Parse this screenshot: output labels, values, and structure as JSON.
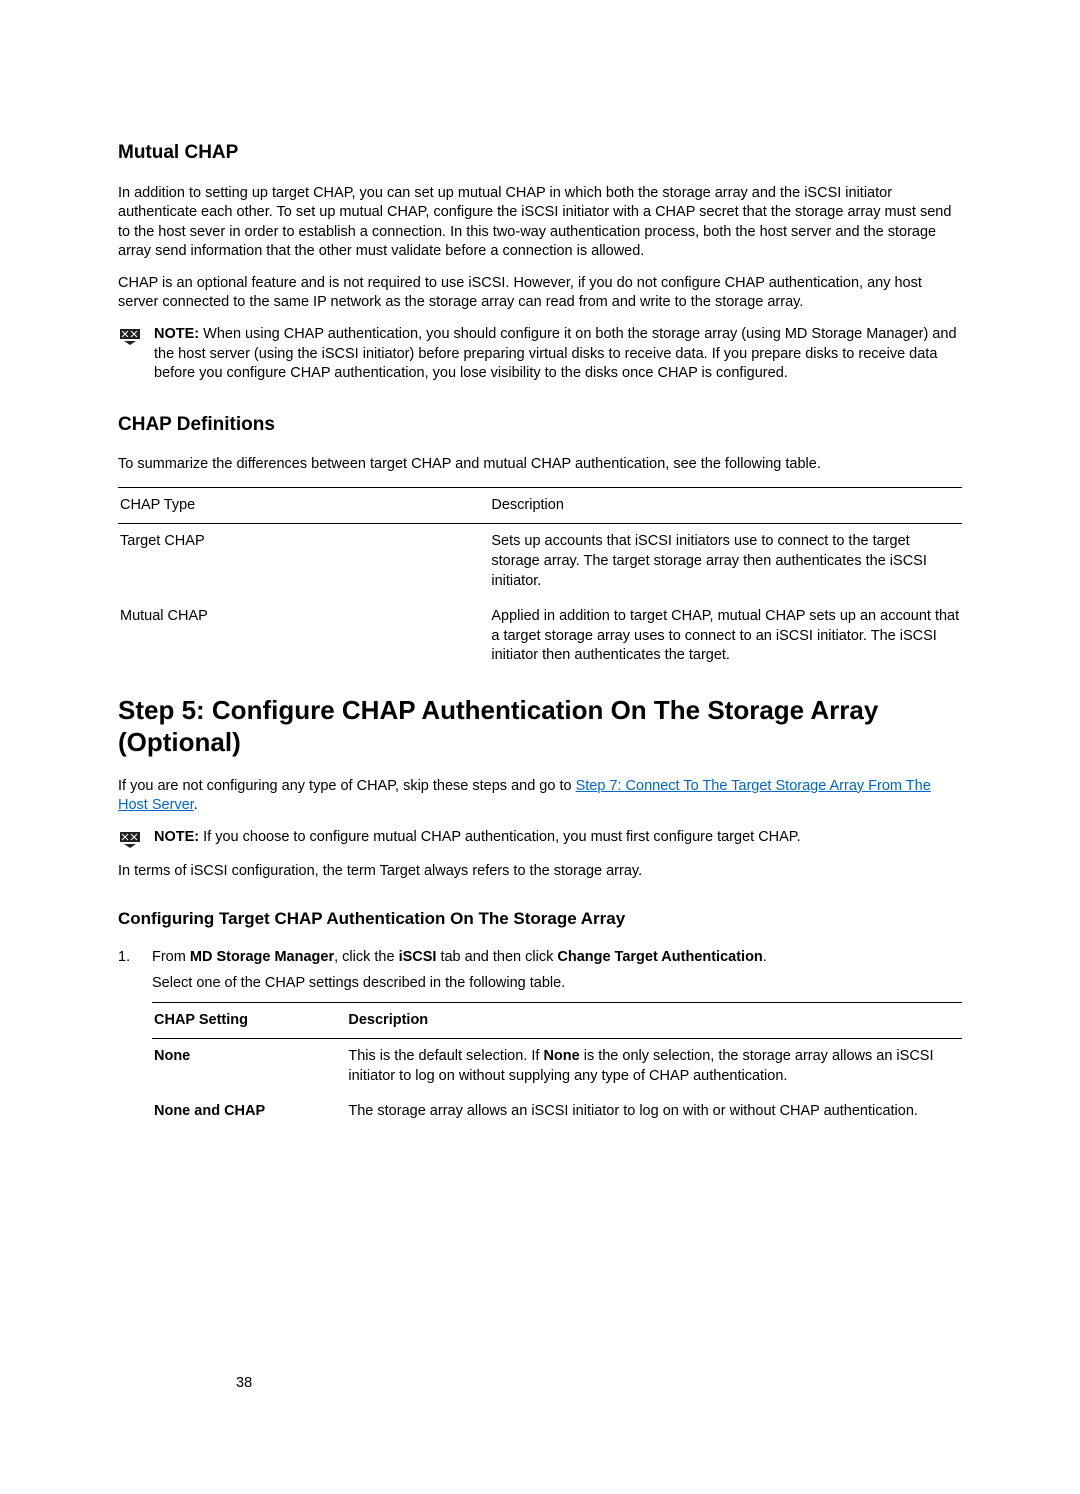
{
  "mutual": {
    "heading": "Mutual CHAP",
    "p1": "In addition to setting up target CHAP, you can set up mutual CHAP in which both the storage array and the iSCSI initiator authenticate each other. To set up mutual CHAP, configure the iSCSI initiator with a CHAP secret that the storage array must send to the host sever in order to establish a connection. In this two-way authentication process, both the host server and the storage array send information that the other must validate before a connection is allowed.",
    "p2": "CHAP is an optional feature and is not required to use iSCSI. However, if you do not configure CHAP authentication, any host server connected to the same IP network as the storage array can read from and write to the storage array.",
    "note_label": "NOTE: ",
    "note_body": "When using CHAP authentication, you should configure it on both the storage array (using MD Storage Manager) and the host server (using the iSCSI initiator) before preparing virtual disks to receive data. If you prepare disks to receive data before you configure CHAP authentication, you lose visibility to the disks once CHAP is configured."
  },
  "defs": {
    "heading": "CHAP Definitions",
    "intro": "To summarize the differences between target CHAP and mutual CHAP authentication, see the following table.",
    "col1": "CHAP Type",
    "col2": "Description",
    "rows": [
      {
        "type": "Target CHAP",
        "desc": "Sets up accounts that iSCSI initiators use to connect to the target storage array. The target storage array then authenticates the iSCSI initiator."
      },
      {
        "type": "Mutual CHAP",
        "desc": "Applied in addition to target CHAP, mutual CHAP sets up an account that a target storage array uses to connect to an iSCSI initiator. The iSCSI initiator then authenticates the target."
      }
    ]
  },
  "step5": {
    "title": "Step 5: Configure CHAP Authentication On The Storage Array (Optional)",
    "p1_a": "If you are not configuring any type of CHAP, skip these steps and go to ",
    "p1_link": "Step 7: Connect To The Target Storage Array From The Host Server",
    "p1_b": ".",
    "note_label": "NOTE: ",
    "note_body": "If you choose to configure mutual CHAP authentication, you must first configure target CHAP.",
    "p2": "In terms of iSCSI configuration, the term Target always refers to the storage array."
  },
  "configure": {
    "heading": "Configuring Target CHAP Authentication On The Storage Array",
    "step1_num": "1.",
    "step1_a": "From ",
    "step1_b": "MD Storage Manager",
    "step1_c": ", click the ",
    "step1_d": "iSCSI",
    "step1_e": " tab and then click ",
    "step1_f": "Change Target Authentication",
    "step1_g": ".",
    "step1_sub": "Select one of the CHAP settings described in the following table.",
    "settings": {
      "col1": "CHAP Setting",
      "col2": "Description",
      "rows": [
        {
          "name": "None",
          "desc_a": "This is the default selection. If ",
          "desc_b": "None",
          "desc_c": " is the only selection, the storage array allows an iSCSI initiator to log on without supplying any type of CHAP authentication."
        },
        {
          "name": "None and CHAP",
          "desc_a": "The storage array allows an iSCSI initiator to log on with or without CHAP authentication.",
          "desc_b": "",
          "desc_c": ""
        }
      ]
    }
  },
  "pagenum": "38"
}
